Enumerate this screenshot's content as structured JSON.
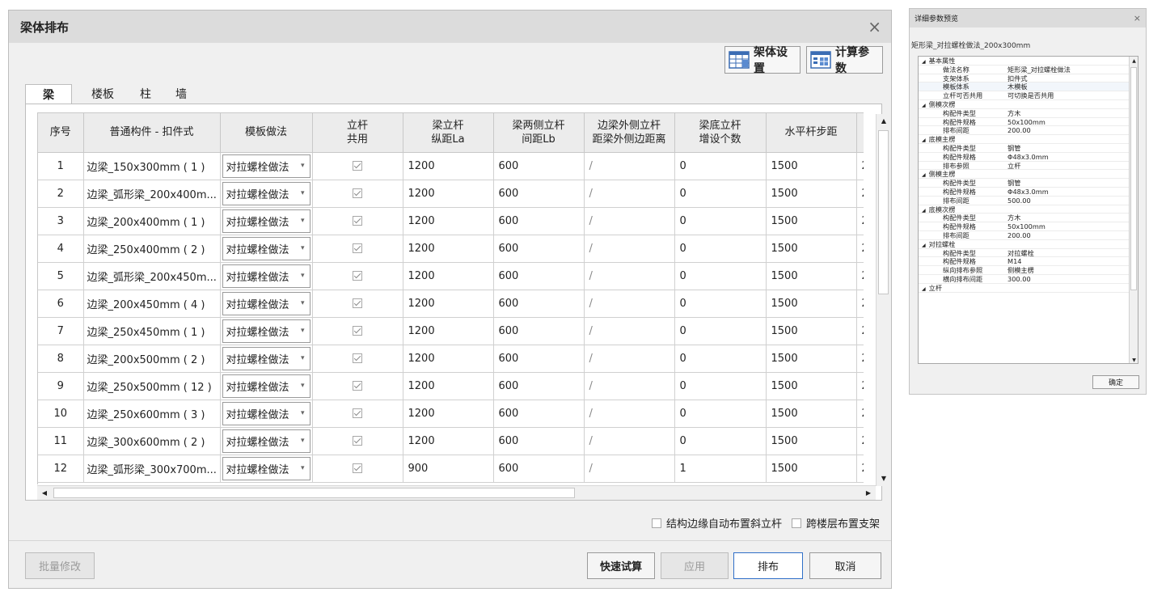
{
  "dialog": {
    "title": "梁体排布",
    "close_label": "×",
    "toolbar": {
      "frame_settings": "架体设置",
      "calc_params": "计算参数"
    },
    "tabs": [
      "梁",
      "楼板",
      "柱",
      "墙"
    ],
    "columns": [
      "序号",
      "普通构件 - 扣件式",
      "模板做法",
      "立杆\n共用",
      "梁立杆\n纵距La",
      "梁两侧立杆\n间距Lb",
      "边梁外侧立杆\n距梁外侧边距离",
      "梁底立杆\n增设个数",
      "水平杆步距",
      ""
    ],
    "rows": [
      {
        "idx": "1",
        "name": "边梁_150x300mm ( 1 )",
        "method": "对拉螺栓做法",
        "la": "1200",
        "lb": "600",
        "edge": "/",
        "extra": "0",
        "step": "1500",
        "next": "2"
      },
      {
        "idx": "2",
        "name": "边梁_弧形梁_200x400m...",
        "method": "对拉螺栓做法",
        "la": "1200",
        "lb": "600",
        "edge": "/",
        "extra": "0",
        "step": "1500",
        "next": "2"
      },
      {
        "idx": "3",
        "name": "边梁_200x400mm ( 1 )",
        "method": "对拉螺栓做法",
        "la": "1200",
        "lb": "600",
        "edge": "/",
        "extra": "0",
        "step": "1500",
        "next": "2"
      },
      {
        "idx": "4",
        "name": "边梁_250x400mm ( 2 )",
        "method": "对拉螺栓做法",
        "la": "1200",
        "lb": "600",
        "edge": "/",
        "extra": "0",
        "step": "1500",
        "next": "2"
      },
      {
        "idx": "5",
        "name": "边梁_弧形梁_200x450m...",
        "method": "对拉螺栓做法",
        "la": "1200",
        "lb": "600",
        "edge": "/",
        "extra": "0",
        "step": "1500",
        "next": "2"
      },
      {
        "idx": "6",
        "name": "边梁_200x450mm ( 4 )",
        "method": "对拉螺栓做法",
        "la": "1200",
        "lb": "600",
        "edge": "/",
        "extra": "0",
        "step": "1500",
        "next": "2"
      },
      {
        "idx": "7",
        "name": "边梁_250x450mm ( 1 )",
        "method": "对拉螺栓做法",
        "la": "1200",
        "lb": "600",
        "edge": "/",
        "extra": "0",
        "step": "1500",
        "next": "2"
      },
      {
        "idx": "8",
        "name": "边梁_200x500mm ( 2 )",
        "method": "对拉螺栓做法",
        "la": "1200",
        "lb": "600",
        "edge": "/",
        "extra": "0",
        "step": "1500",
        "next": "2"
      },
      {
        "idx": "9",
        "name": "边梁_250x500mm ( 12 )",
        "method": "对拉螺栓做法",
        "la": "1200",
        "lb": "600",
        "edge": "/",
        "extra": "0",
        "step": "1500",
        "next": "2"
      },
      {
        "idx": "10",
        "name": "边梁_250x600mm ( 3 )",
        "method": "对拉螺栓做法",
        "la": "1200",
        "lb": "600",
        "edge": "/",
        "extra": "0",
        "step": "1500",
        "next": "2"
      },
      {
        "idx": "11",
        "name": "边梁_300x600mm ( 2 )",
        "method": "对拉螺栓做法",
        "la": "1200",
        "lb": "600",
        "edge": "/",
        "extra": "0",
        "step": "1500",
        "next": "2"
      },
      {
        "idx": "12",
        "name": "边梁_弧形梁_300x700m...",
        "method": "对拉螺栓做法",
        "la": "900",
        "lb": "600",
        "edge": "/",
        "extra": "1",
        "step": "1500",
        "next": "2"
      }
    ],
    "options": {
      "auto_diagonal": "结构边缘自动布置斜立杆",
      "cross_floor": "跨楼层布置支架"
    },
    "buttons": {
      "batch_edit": "批量修改",
      "quick_calc": "快速试算",
      "apply": "应用",
      "arrange": "排布",
      "cancel": "取消"
    },
    "accent_color": "#2f6fc8"
  },
  "side_panel": {
    "title": "详细参数预览",
    "close_label": "×",
    "subtitle": "矩形梁_对拉螺栓做法_200x300mm",
    "confirm": "确定",
    "groups": [
      {
        "name": "基本属性",
        "items": [
          {
            "k": "做法名称",
            "v": "矩形梁_对拉螺栓做法"
          },
          {
            "k": "支架体系",
            "v": "扣件式"
          },
          {
            "k": "模板体系",
            "v": "木模板"
          },
          {
            "k": "立杆可否共用",
            "v": "可切换是否共用"
          }
        ]
      },
      {
        "name": "侧模次楞",
        "items": [
          {
            "k": "构配件类型",
            "v": "方木"
          },
          {
            "k": "构配件规格",
            "v": "50x100mm"
          },
          {
            "k": "排布间距",
            "v": "200.00"
          }
        ]
      },
      {
        "name": "底模主楞",
        "items": [
          {
            "k": "构配件类型",
            "v": "钢管"
          },
          {
            "k": "构配件规格",
            "v": "Φ48x3.0mm"
          },
          {
            "k": "排布参照",
            "v": "立杆"
          }
        ]
      },
      {
        "name": "侧模主楞",
        "items": [
          {
            "k": "构配件类型",
            "v": "钢管"
          },
          {
            "k": "构配件规格",
            "v": "Φ48x3.0mm"
          },
          {
            "k": "排布间距",
            "v": "500.00"
          }
        ]
      },
      {
        "name": "底模次楞",
        "items": [
          {
            "k": "构配件类型",
            "v": "方木"
          },
          {
            "k": "构配件规格",
            "v": "50x100mm"
          },
          {
            "k": "排布间距",
            "v": "200.00"
          }
        ]
      },
      {
        "name": "对拉螺栓",
        "items": [
          {
            "k": "构配件类型",
            "v": "对拉螺栓"
          },
          {
            "k": "构配件规格",
            "v": "M14"
          },
          {
            "k": "纵向排布参照",
            "v": "侧模主楞"
          },
          {
            "k": "横向排布间距",
            "v": "300.00"
          }
        ]
      },
      {
        "name": "立杆",
        "items": []
      }
    ]
  }
}
